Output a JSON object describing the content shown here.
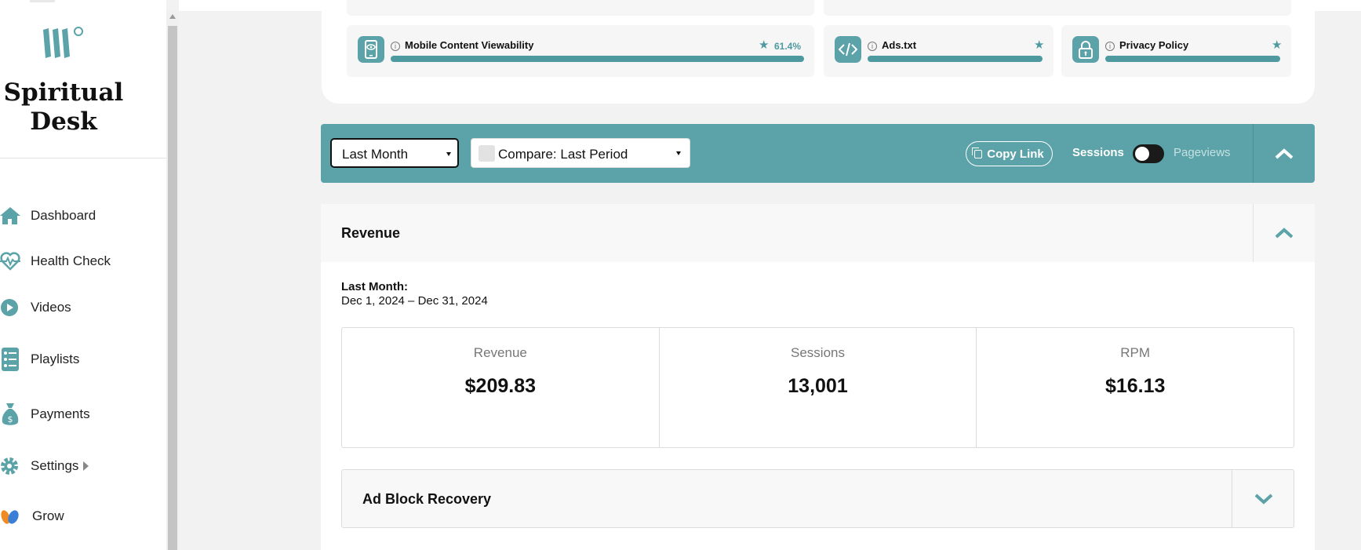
{
  "brand": {
    "name": "Spiritual Desk",
    "accent": "#5ba3a8"
  },
  "sidebar": {
    "items": [
      {
        "label": "Dashboard",
        "icon": "home-icon"
      },
      {
        "label": "Health Check",
        "icon": "heartbeat-icon"
      },
      {
        "label": "Videos",
        "icon": "play-icon"
      },
      {
        "label": "Playlists",
        "icon": "checklist-icon"
      },
      {
        "label": "Payments",
        "icon": "money-bag-icon"
      },
      {
        "label": "Settings",
        "icon": "gear-icon"
      },
      {
        "label": "Grow",
        "icon": "grow-leaves-icon"
      }
    ]
  },
  "health": {
    "tiles": [
      {
        "title": "Mobile Content Viewability",
        "value": "61.4%",
        "icon": "mobile-eye-icon"
      },
      {
        "title": "Ads.txt",
        "icon": "code-icon"
      },
      {
        "title": "Privacy Policy",
        "icon": "lock-icon"
      }
    ]
  },
  "toolbar": {
    "range_value": "Last Month",
    "compare_value": "Compare: Last Period",
    "copy_link": "Copy Link",
    "sessions_label": "Sessions",
    "pageviews_label": "Pageviews"
  },
  "revenue": {
    "title": "Revenue",
    "period_label": "Last Month:",
    "period_range": "Dec 1, 2024 – Dec 31, 2024",
    "metrics": [
      {
        "label": "Revenue",
        "value": "$209.83"
      },
      {
        "label": "Sessions",
        "value": "13,001"
      },
      {
        "label": "RPM",
        "value": "$16.13"
      }
    ],
    "ad_block_title": "Ad Block Recovery"
  }
}
